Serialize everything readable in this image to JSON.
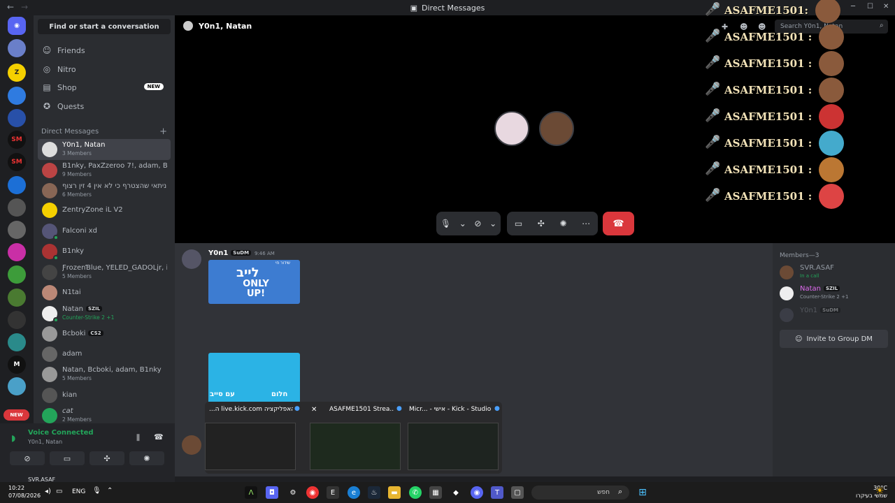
{
  "titlebar": {
    "title": "Direct Messages"
  },
  "sidebar": {
    "find_label": "Find or start a conversation",
    "nav": [
      {
        "label": "Friends"
      },
      {
        "label": "Nitro"
      },
      {
        "label": "Shop",
        "badge": "NEW"
      },
      {
        "label": "Quests"
      }
    ],
    "dm_header": "Direct Messages",
    "dms": [
      {
        "name": "Y0n1, Natan",
        "sub": "3 Members"
      },
      {
        "name": "B1nky, PaxZzeroo 7!, adam, Bcb...",
        "sub": "9 Members"
      },
      {
        "name": "וניתאי שהצטרף כי לא אין 4 זין רצוף...",
        "sub": "6 Members"
      },
      {
        "name": "ZentryZone iL V2",
        "sub": ""
      },
      {
        "name": "Falconi xd",
        "sub": ""
      },
      {
        "name": "B1nky",
        "sub": ""
      },
      {
        "name": "ƑrozenƁlue, YELED_GADOLjr, it...",
        "sub": "5 Members"
      },
      {
        "name": "N1tai",
        "sub": ""
      },
      {
        "name": "Natan",
        "tag": "SZIL",
        "sub": "Counter-Strike 2 +1"
      },
      {
        "name": "Bcboki",
        "tag": "CS2",
        "sub": ""
      },
      {
        "name": "adam",
        "sub": ""
      },
      {
        "name": "Natan, Bcboki, adam, B1nky",
        "sub": "5 Members"
      },
      {
        "name": "kian",
        "sub": ""
      },
      {
        "name": "cat",
        "sub": "2 Members"
      }
    ],
    "new_pill": "NEW"
  },
  "voice": {
    "status": "Voice Connected",
    "channel": "Y0n1, Natan",
    "user": "SVR.ASAF"
  },
  "call": {
    "title": "Y0n1, Natan"
  },
  "overlay": {
    "lines": [
      "ASAFME1501:",
      "ASAFME1501 :",
      "ASAFME1501 :",
      "ASAFME1501 :",
      "ASAFME1501 :",
      "ASAFME1501 :",
      "ASAFME1501 :",
      "ASAFME1501 :"
    ],
    "search_placeholder": "Search Y0n1, Natan"
  },
  "chat": {
    "author": "Y0n1",
    "author_tag": "SuDM",
    "time": "9:46 AM",
    "img1_top": "שידור חי",
    "img1_mid": "לייב",
    "img1_big": "ONLY UP!",
    "img2_left": "עם סייב",
    "img2_right": "חלום"
  },
  "members": {
    "header": "Members—3",
    "list": [
      {
        "name": "SVR.ASAF",
        "sub": "In a call"
      },
      {
        "name": "Natan",
        "tag": "SZIL",
        "sub": "Counter-Strike 2 +1"
      },
      {
        "name": "Y0n1",
        "tag": "SuDM",
        "sub": ""
      }
    ],
    "invite": "Invite to Group DM"
  },
  "thumbnails": [
    {
      "title": "...ה live.kick.com האפליקציה"
    },
    {
      "title": "ASAFME1501 Strea..."
    },
    {
      "title": "Micr... - אישי - Kick - Studio"
    }
  ],
  "taskbar": {
    "time": "10:22",
    "date": "07/08/2026",
    "lang": "ENG",
    "search": "חפש",
    "temp": "30°C",
    "weather": "שמשי בעיקרו"
  }
}
